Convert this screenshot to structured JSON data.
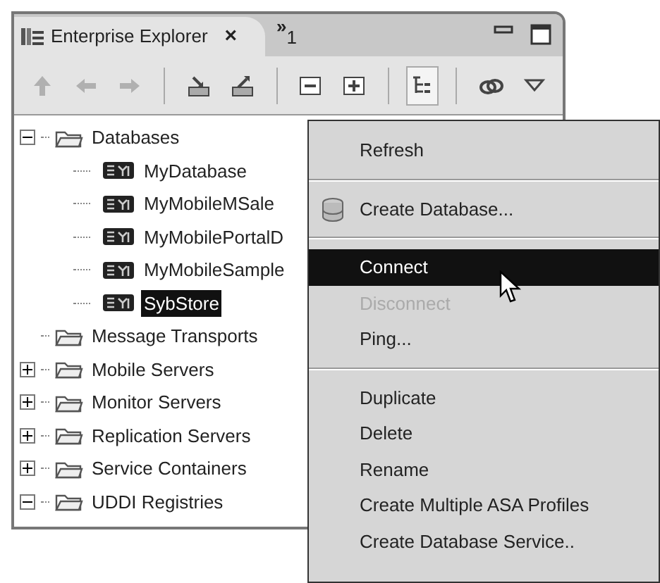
{
  "view": {
    "tab": {
      "title": "Enterprise Explorer",
      "close": "×"
    },
    "overflow": {
      "chevron": "»",
      "count": "1"
    }
  },
  "toolbar": [
    {
      "kind": "up",
      "disabled": true,
      "pressed": false
    },
    {
      "kind": "back",
      "disabled": true,
      "pressed": false
    },
    {
      "kind": "forward",
      "disabled": true,
      "pressed": false
    },
    {
      "kind": "import",
      "disabled": false,
      "pressed": false
    },
    {
      "kind": "export",
      "disabled": false,
      "pressed": false
    },
    {
      "kind": "collapse",
      "disabled": false,
      "pressed": false
    },
    {
      "kind": "expand",
      "disabled": false,
      "pressed": false
    },
    {
      "kind": "tree",
      "disabled": false,
      "pressed": true
    },
    {
      "kind": "link",
      "disabled": false,
      "pressed": false
    },
    {
      "kind": "menu",
      "disabled": false,
      "pressed": false
    }
  ],
  "tree": [
    {
      "label": "Databases",
      "kind": "folder",
      "expanded": true,
      "selected": false,
      "children": [
        {
          "label": "MyDatabase",
          "kind": "database",
          "selected": false
        },
        {
          "label": "MyMobileMSale",
          "kind": "database",
          "selected": false
        },
        {
          "label": "MyMobilePortalD",
          "kind": "database",
          "selected": false
        },
        {
          "label": "MyMobileSample",
          "kind": "database",
          "selected": false
        },
        {
          "label": "SybStore",
          "kind": "database",
          "selected": true
        }
      ]
    },
    {
      "label": "Message Transports",
      "kind": "folder",
      "selected": false
    },
    {
      "label": "Mobile Servers",
      "kind": "folder",
      "expanded": false,
      "selected": false
    },
    {
      "label": "Monitor Servers",
      "kind": "folder",
      "expanded": false,
      "selected": false
    },
    {
      "label": "Replication Servers",
      "kind": "folder",
      "expanded": false,
      "selected": false
    },
    {
      "label": "Service Containers",
      "kind": "folder",
      "expanded": false,
      "selected": false
    },
    {
      "label": "UDDI Registries",
      "kind": "folder",
      "expanded": true,
      "selected": false
    }
  ],
  "context_menu": [
    {
      "kind": "item",
      "label": "Refresh",
      "disabled": false,
      "selected": false
    },
    {
      "kind": "separator"
    },
    {
      "kind": "icon-item",
      "label": "Create Database...",
      "disabled": false,
      "selected": false
    },
    {
      "kind": "separator"
    },
    {
      "kind": "item",
      "label": "Connect",
      "disabled": false,
      "selected": true
    },
    {
      "kind": "item",
      "label": "Disconnect",
      "disabled": true,
      "selected": false
    },
    {
      "kind": "item",
      "label": "Ping...",
      "disabled": false,
      "selected": false
    },
    {
      "kind": "separator"
    },
    {
      "kind": "item",
      "label": "Duplicate",
      "disabled": false,
      "selected": false
    },
    {
      "kind": "item",
      "label": "Delete",
      "disabled": false,
      "selected": false
    },
    {
      "kind": "item",
      "label": "Rename",
      "disabled": false,
      "selected": false
    },
    {
      "kind": "item",
      "label": "Create Multiple ASA Profiles",
      "disabled": false,
      "selected": false
    },
    {
      "kind": "item",
      "label": "Create Database Service..",
      "disabled": false,
      "selected": false
    }
  ]
}
